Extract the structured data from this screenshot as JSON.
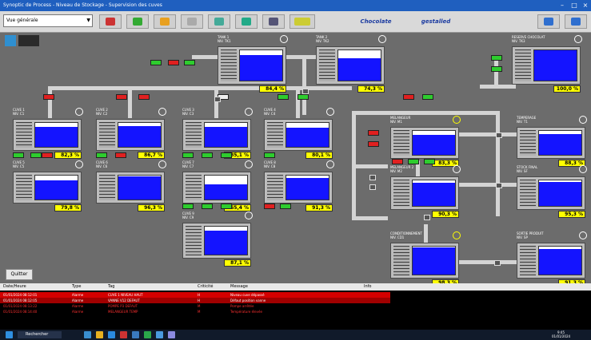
{
  "window": {
    "title": "Synoptic de Process - Niveau de Stockage - Supervision des cuves"
  },
  "toolbar": {
    "dropdown_value": "Vue générale",
    "label_1": "Chocolate",
    "label_2": "gestalled"
  },
  "quit_button": "Quitter",
  "tanks": [
    {
      "id": "t1",
      "label": "TANK 1\nNIV. TK1",
      "level": 0.84,
      "pct": "84,4 %"
    },
    {
      "id": "t2",
      "label": "TANK 2\nNIV. TK2",
      "level": 0.74,
      "pct": "74,3 %"
    },
    {
      "id": "t3",
      "label": "RESERVE CHOCOLAT\nNIV. TK3",
      "level": 1.0,
      "pct": "100,0 %"
    },
    {
      "id": "t4",
      "label": "CUVE 1\nNIV. C1",
      "level": 0.83,
      "pct": "82,3 %"
    },
    {
      "id": "t5",
      "label": "CUVE 2\nNIV. C2",
      "level": 0.87,
      "pct": "86,7 %"
    },
    {
      "id": "t6",
      "label": "CUVE 3\nNIV. C3",
      "level": 0.85,
      "pct": "85,1 %"
    },
    {
      "id": "t7",
      "label": "CUVE 4\nNIV. C4",
      "level": 0.8,
      "pct": "80,1 %"
    },
    {
      "id": "t8",
      "label": "CUVE 5\nNIV. C5",
      "level": 0.8,
      "pct": "79,8 %"
    },
    {
      "id": "t9",
      "label": "CUVE 6\nNIV. C6",
      "level": 0.96,
      "pct": "96,3 %"
    },
    {
      "id": "t10",
      "label": "CUVE 7\nNIV. C7",
      "level": 0.65,
      "pct": "65,4 %"
    },
    {
      "id": "t11",
      "label": "CUVE 8\nNIV. C8",
      "level": 0.91,
      "pct": "91,3 %"
    },
    {
      "id": "t12",
      "label": "CUVE 9\nNIV. C9",
      "level": 0.87,
      "pct": "87,1 %"
    },
    {
      "id": "t13",
      "label": "MELANGEUR\nNIV. M1",
      "level": 0.83,
      "pct": "83,3 %"
    },
    {
      "id": "t14",
      "label": "MELANGEUR 2\nNIV. M2",
      "level": 0.9,
      "pct": "90,3 %"
    },
    {
      "id": "t15",
      "label": "CONDITIONNEMENT\nNIV. CD1",
      "level": 0.98,
      "pct": "98,3 %"
    },
    {
      "id": "t16",
      "label": "TEMPERAGE\nNIV. T1",
      "level": 0.88,
      "pct": "88,3 %"
    },
    {
      "id": "t17",
      "label": "STOCK FINAL\nNIV. SF",
      "level": 0.95,
      "pct": "95,3 %"
    },
    {
      "id": "t18",
      "label": "SORTIE PRODUIT\nNIV. SP",
      "level": 0.91,
      "pct": "91,3 %"
    }
  ],
  "alarm": {
    "headers": [
      "Date/Heure",
      "Type",
      "Tag",
      "Criticité",
      "Message",
      "Info"
    ],
    "rows": [
      [
        "01/01/2024 08:12:01",
        "Alarme",
        "CUVE 1 NIVEAU HAUT",
        "H",
        "Niveau cuve dépassé",
        ""
      ],
      [
        "01/01/2024 08:12:05",
        "Alarme",
        "VANNE V12 DEFAUT",
        "H",
        "Défaut position vanne",
        ""
      ],
      [
        "01/01/2024 08:13:22",
        "Alarme",
        "POMPE P3 DEFAUT",
        "M",
        "Pompe arrêtée",
        ""
      ],
      [
        "01/01/2024 08:14:40",
        "Alarme",
        "MELANGEUR TEMP",
        "M",
        "Température élevée",
        ""
      ]
    ]
  },
  "taskbar": {
    "search": "Rechercher",
    "clock": "9:45",
    "date": "01/01/2024"
  }
}
